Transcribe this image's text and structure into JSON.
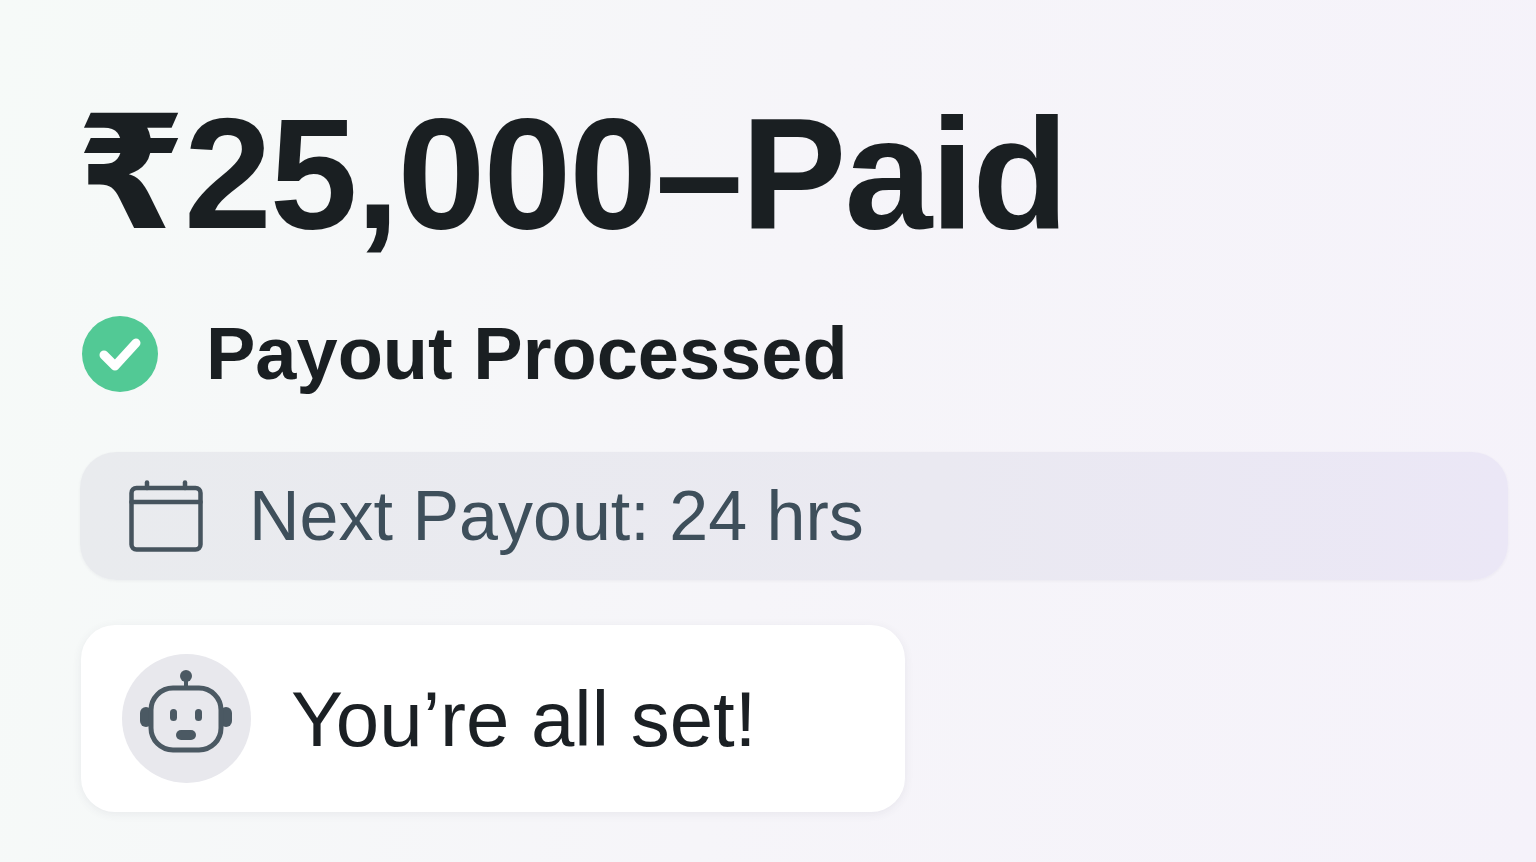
{
  "headline": {
    "text": "₹25,000–Paid"
  },
  "status": {
    "text": "Payout Processed",
    "completed": true
  },
  "next_payout": {
    "text": "Next Payout: 24 hrs"
  },
  "message": {
    "text": "You’re all set!"
  }
}
